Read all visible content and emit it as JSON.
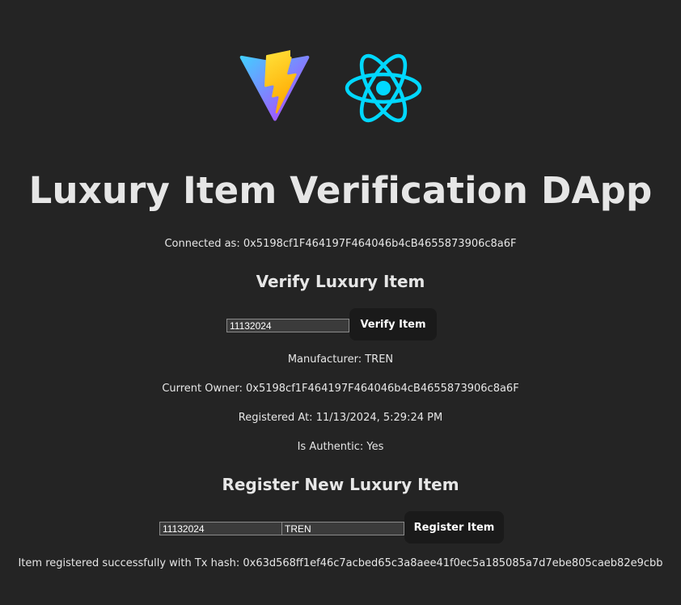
{
  "app": {
    "title": "Luxury Item Verification DApp",
    "connected_text": "Connected as: 0x5198cf1F464197F464046b4cB4655873906c8a6F"
  },
  "logos": {
    "vite": "vite-logo-icon",
    "react": "react-logo-icon"
  },
  "verify": {
    "heading": "Verify Luxury Item",
    "input_value": "11132024",
    "button_label": "Verify Item",
    "manufacturer": "Manufacturer: TREN",
    "current_owner": "Current Owner: 0x5198cf1F464197F464046b4cB4655873906c8a6F",
    "registered_at": "Registered At: 11/13/2024, 5:29:24 PM",
    "is_authentic": "Is Authentic: Yes"
  },
  "register": {
    "heading": "Register New Luxury Item",
    "item_id_value": "11132024",
    "manufacturer_value": "TREN",
    "button_label": "Register Item",
    "status_message": "Item registered successfully with Tx hash: 0x63d568ff1ef46c7acbed65c3a8aee41f0ec5a185085a7d7ebe805caeb82e9cbb"
  },
  "colors": {
    "background": "#242424",
    "button_bg": "#1a1a1a",
    "react_cyan": "#00d8ff"
  }
}
